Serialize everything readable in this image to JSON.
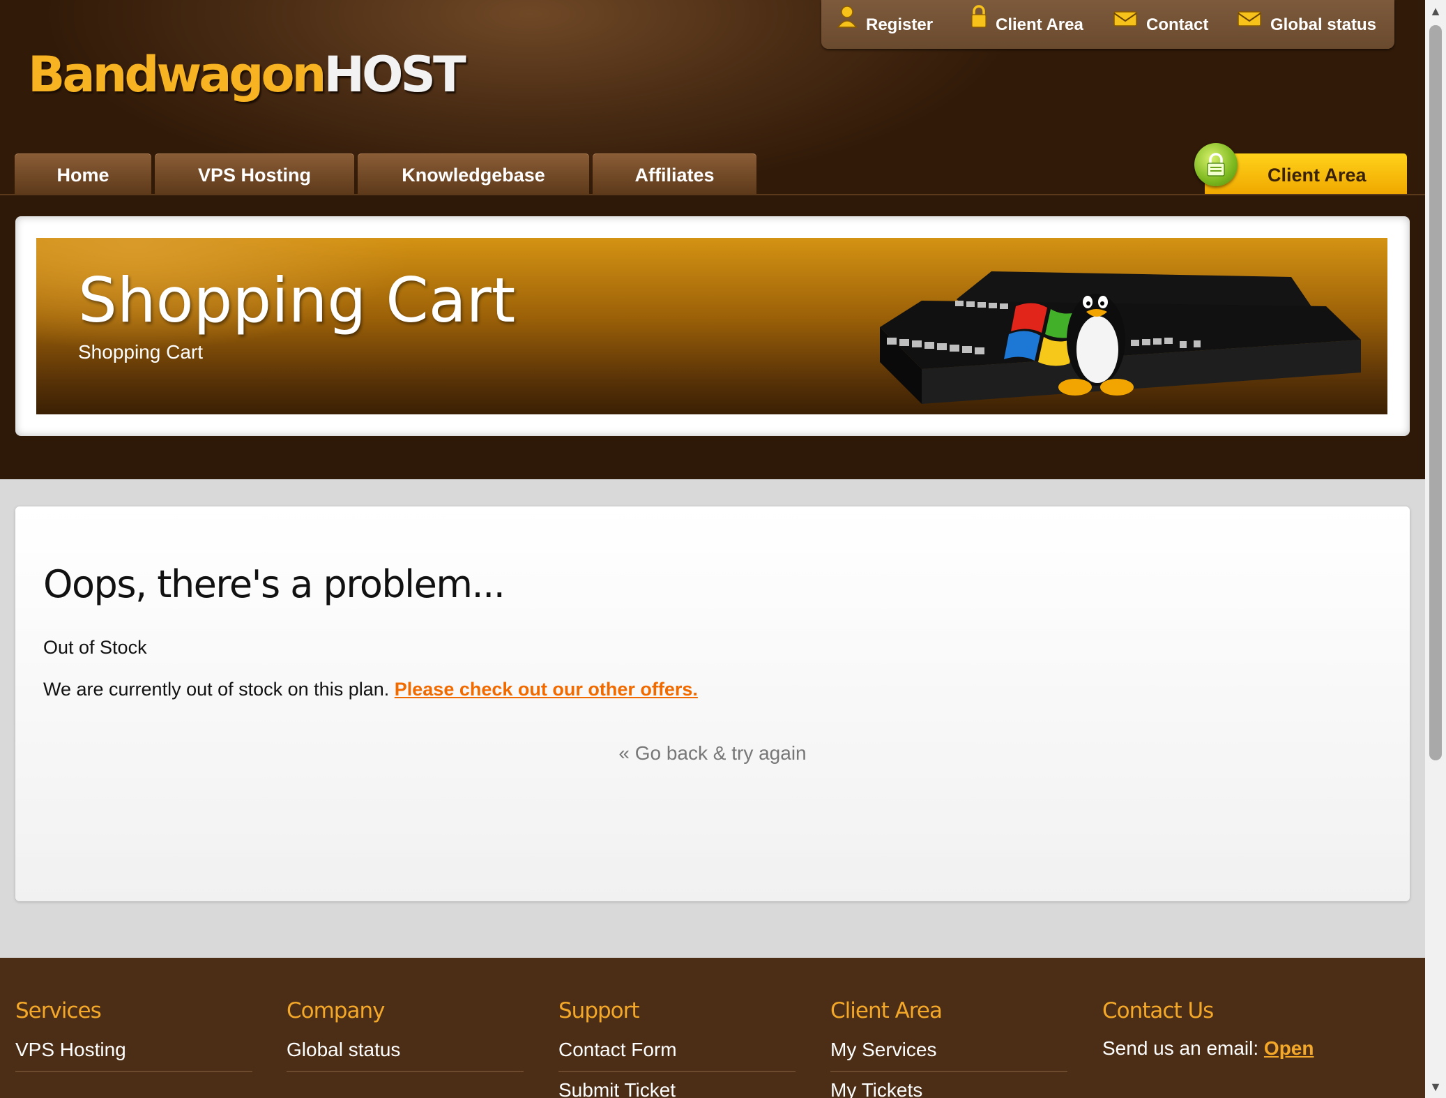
{
  "brand": {
    "name_part1": "Bandwagon",
    "name_part2": "HOST"
  },
  "top_links": [
    {
      "label": "Register",
      "icon": "user-icon"
    },
    {
      "label": "Client Area",
      "icon": "lock-icon"
    },
    {
      "label": "Contact",
      "icon": "envelope-icon"
    },
    {
      "label": "Global status",
      "icon": "envelope-icon"
    }
  ],
  "nav": {
    "tabs": [
      "Home",
      "VPS Hosting",
      "Knowledgebase",
      "Affiliates"
    ],
    "client_area": "Client Area"
  },
  "banner": {
    "title": "Shopping Cart",
    "subtitle": "Shopping Cart"
  },
  "error": {
    "title": "Oops, there's a problem...",
    "subtitle": "Out of Stock",
    "message": "We are currently out of stock on this plan.",
    "link": "Please check out our other offers.",
    "back": "« Go back & try again"
  },
  "footer": {
    "columns": [
      {
        "title": "Services",
        "items": [
          "VPS Hosting"
        ]
      },
      {
        "title": "Company",
        "items": [
          "Global status"
        ]
      },
      {
        "title": "Support",
        "items": [
          "Contact Form",
          "Submit Ticket"
        ]
      },
      {
        "title": "Client Area",
        "items": [
          "My Services",
          "My Tickets"
        ]
      },
      {
        "title": "Contact Us",
        "email_prefix": "Send us an email:",
        "email_link": "Open"
      }
    ]
  },
  "colors": {
    "accent": "#f3a82a",
    "link": "#f06a00",
    "header_bg": "#311a08",
    "footer_bg": "#4c2d15"
  }
}
